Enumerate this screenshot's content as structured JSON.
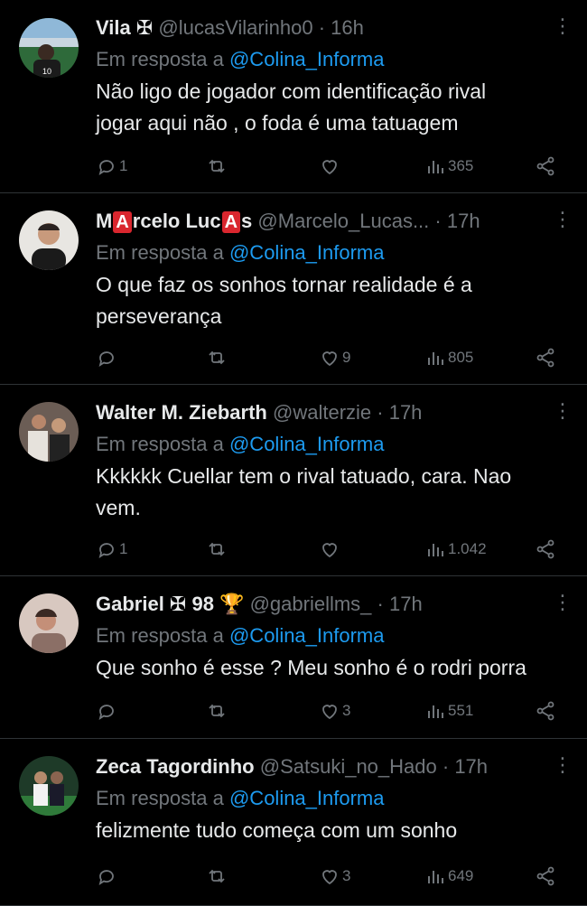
{
  "reply_prefix": "Em resposta a",
  "colors": {
    "link": "#1d9bf0",
    "muted": "#71767b",
    "text": "#e7e9ea"
  },
  "tweets": [
    {
      "name": "Vila ✠",
      "handle": "@lucasVilarinho0",
      "time": "· 16h",
      "reply_to": "@Colina_Informa",
      "text": "Não ligo de jogador com identificação rival\njogar aqui não , o foda é uma tatuagem",
      "replies": "1",
      "likes": "",
      "views": "365"
    },
    {
      "name_parts": [
        "M",
        "A",
        "rcelo Luc",
        "A",
        "s"
      ],
      "handle": "@Marcelo_Lucas...",
      "time": "· 17h",
      "reply_to": "@Colina_Informa",
      "text": "O que faz os sonhos tornar realidade é a\nperseverança",
      "replies": "",
      "likes": "9",
      "views": "805"
    },
    {
      "name": "Walter M. Ziebarth",
      "handle": "@walterzie",
      "time": "· 17h",
      "reply_to": "@Colina_Informa",
      "text": "Kkkkkk Cuellar tem o rival tatuado, cara. Nao\nvem.",
      "replies": "1",
      "likes": "",
      "views": "1.042"
    },
    {
      "name": "Gabriel ✠ 98 🏆",
      "handle": "@gabriellms_",
      "time": "· 17h",
      "reply_to": "@Colina_Informa",
      "text": "Que sonho é esse ? Meu sonho é o rodri porra",
      "replies": "",
      "likes": "3",
      "views": "551"
    },
    {
      "name": "Zeca Tagordinho",
      "handle": "@Satsuki_no_Hado",
      "time": "· 17h",
      "reply_to": "@Colina_Informa",
      "text": "felizmente tudo começa com um sonho",
      "replies": "",
      "likes": "3",
      "views": "649"
    }
  ]
}
